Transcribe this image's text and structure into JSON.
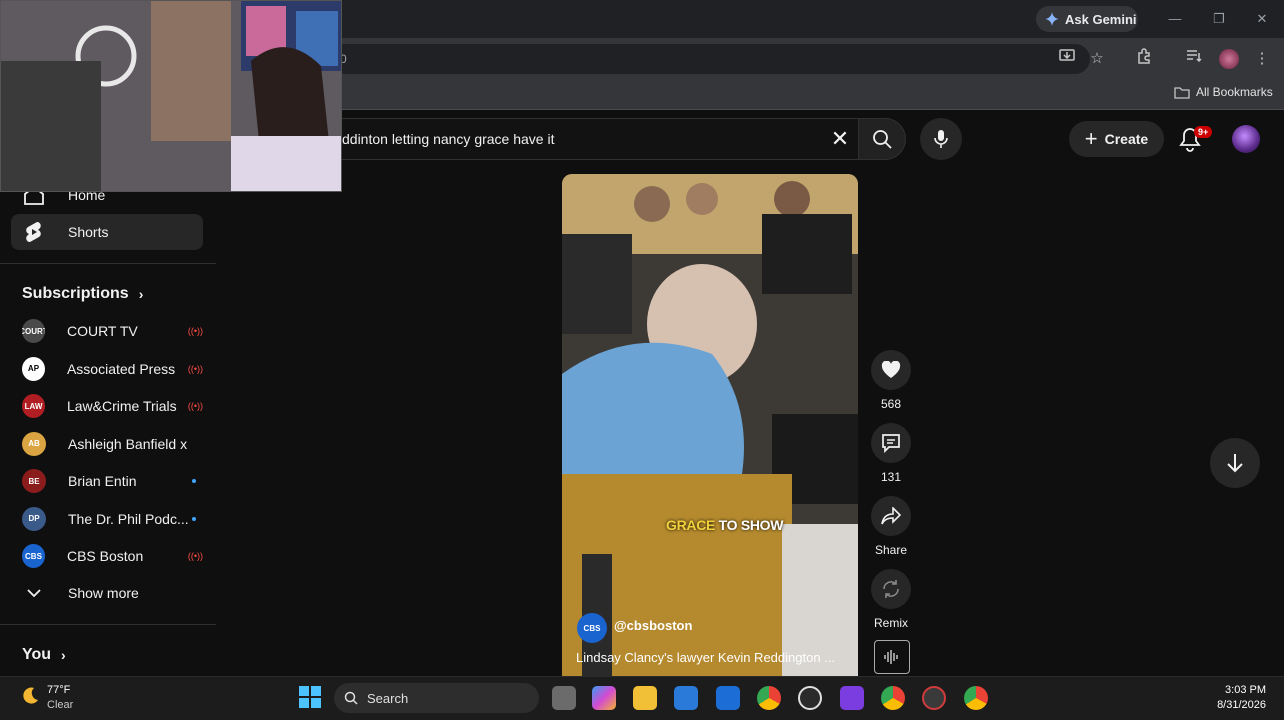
{
  "browser": {
    "gemini_label": "Ask Gemini",
    "omnibox_fragment": "0",
    "bookmarks_label": "All Bookmarks"
  },
  "youtube": {
    "search_query": "ddinton letting nancy grace have it",
    "create_label": "Create",
    "notification_count": "9+",
    "sidebar": {
      "home_label": "Home",
      "shorts_label": "Shorts",
      "subscriptions_heading": "Subscriptions",
      "channels": [
        {
          "name": "COURT TV",
          "avatar_text": "COURT",
          "avatar_color": "#4a4a4a",
          "status": "live"
        },
        {
          "name": "Associated Press",
          "avatar_text": "AP",
          "avatar_color": "#ffffff",
          "status": "live"
        },
        {
          "name": "Law&Crime Trials",
          "avatar_text": "LAW",
          "avatar_color": "#b01e23",
          "status": "live"
        },
        {
          "name": "Ashleigh Banfield x ...",
          "avatar_text": "AB",
          "avatar_color": "#d9a441",
          "status": "none"
        },
        {
          "name": "Brian Entin",
          "avatar_text": "BE",
          "avatar_color": "#8a1c1c",
          "status": "new"
        },
        {
          "name": "The Dr. Phil Podc...",
          "avatar_text": "DP",
          "avatar_color": "#3a5a8a",
          "status": "new"
        },
        {
          "name": "CBS Boston",
          "avatar_text": "CBS",
          "avatar_color": "#1a64d0",
          "status": "live"
        }
      ],
      "show_more_label": "Show more",
      "you_heading": "You"
    },
    "short": {
      "caption_highlight": "GRACE",
      "caption_rest": " TO SHOW",
      "channel_handle": "@cbsboston",
      "channel_avatar_text": "CBS",
      "title": "Lindsay Clancy's lawyer Kevin Reddington ...",
      "likes": "568",
      "comments": "131",
      "share_label": "Share",
      "remix_label": "Remix"
    }
  },
  "taskbar": {
    "temperature": "77°F",
    "condition": "Clear",
    "search_label": "Search",
    "time": "3:03 PM",
    "date": "8/31/2026"
  },
  "colors": {
    "background": "#0f0f0f",
    "accent_red": "#cc0000",
    "live_red": "#ff4e45",
    "new_blue": "#3ea6ff",
    "caption_yellow": "#f1d13b"
  }
}
